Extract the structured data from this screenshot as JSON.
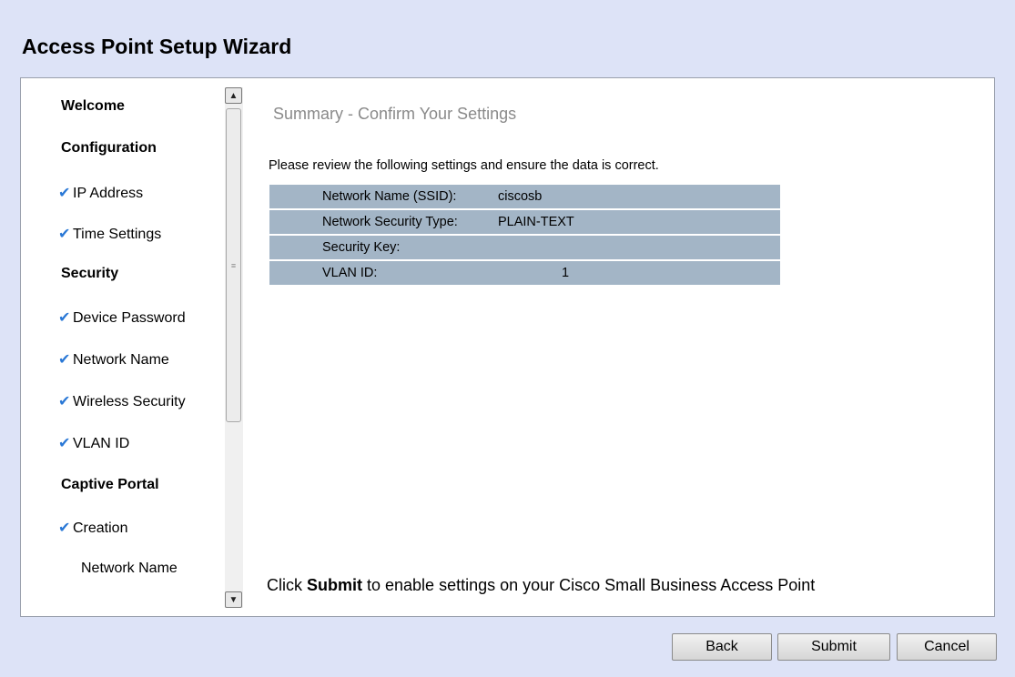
{
  "wizard": {
    "title": "Access Point Setup Wizard"
  },
  "sidebar": {
    "items": [
      {
        "label": "Welcome",
        "type": "section",
        "checked": false
      },
      {
        "label": "Configuration",
        "type": "section",
        "checked": false
      },
      {
        "label": "IP Address",
        "type": "step",
        "checked": true
      },
      {
        "label": "Time Settings",
        "type": "step",
        "checked": true
      },
      {
        "label": "Security",
        "type": "section",
        "checked": false
      },
      {
        "label": "Device Password",
        "type": "step",
        "checked": true
      },
      {
        "label": "Network Name",
        "type": "step",
        "checked": true
      },
      {
        "label": "Wireless Security",
        "type": "step",
        "checked": true
      },
      {
        "label": "VLAN ID",
        "type": "step",
        "checked": true
      },
      {
        "label": "Captive Portal",
        "type": "section",
        "checked": false
      },
      {
        "label": "Creation",
        "type": "step",
        "checked": true
      },
      {
        "label": "Network Name",
        "type": "step",
        "checked": false
      }
    ],
    "check_glyph": "✔",
    "check_color": "#2a78d6"
  },
  "main": {
    "heading": "Summary - Confirm Your Settings",
    "review_text": "Please review the following settings and ensure the data is correct.",
    "summary_rows": [
      {
        "label": "Network Name (SSID):",
        "value": "ciscosb"
      },
      {
        "label": "Network Security Type:",
        "value": "PLAIN-TEXT"
      },
      {
        "label": "Security Key:",
        "value": ""
      },
      {
        "label": "VLAN ID:",
        "value": "1"
      }
    ],
    "footer_prefix": "Click ",
    "footer_bold": "Submit",
    "footer_suffix": " to enable settings on your Cisco Small Business Access Point"
  },
  "buttons": {
    "back": "Back",
    "submit": "Submit",
    "cancel": "Cancel"
  },
  "colors": {
    "background": "#dde3f7",
    "table_row": "#a3b5c6",
    "heading_gray": "#8a8a8a"
  }
}
